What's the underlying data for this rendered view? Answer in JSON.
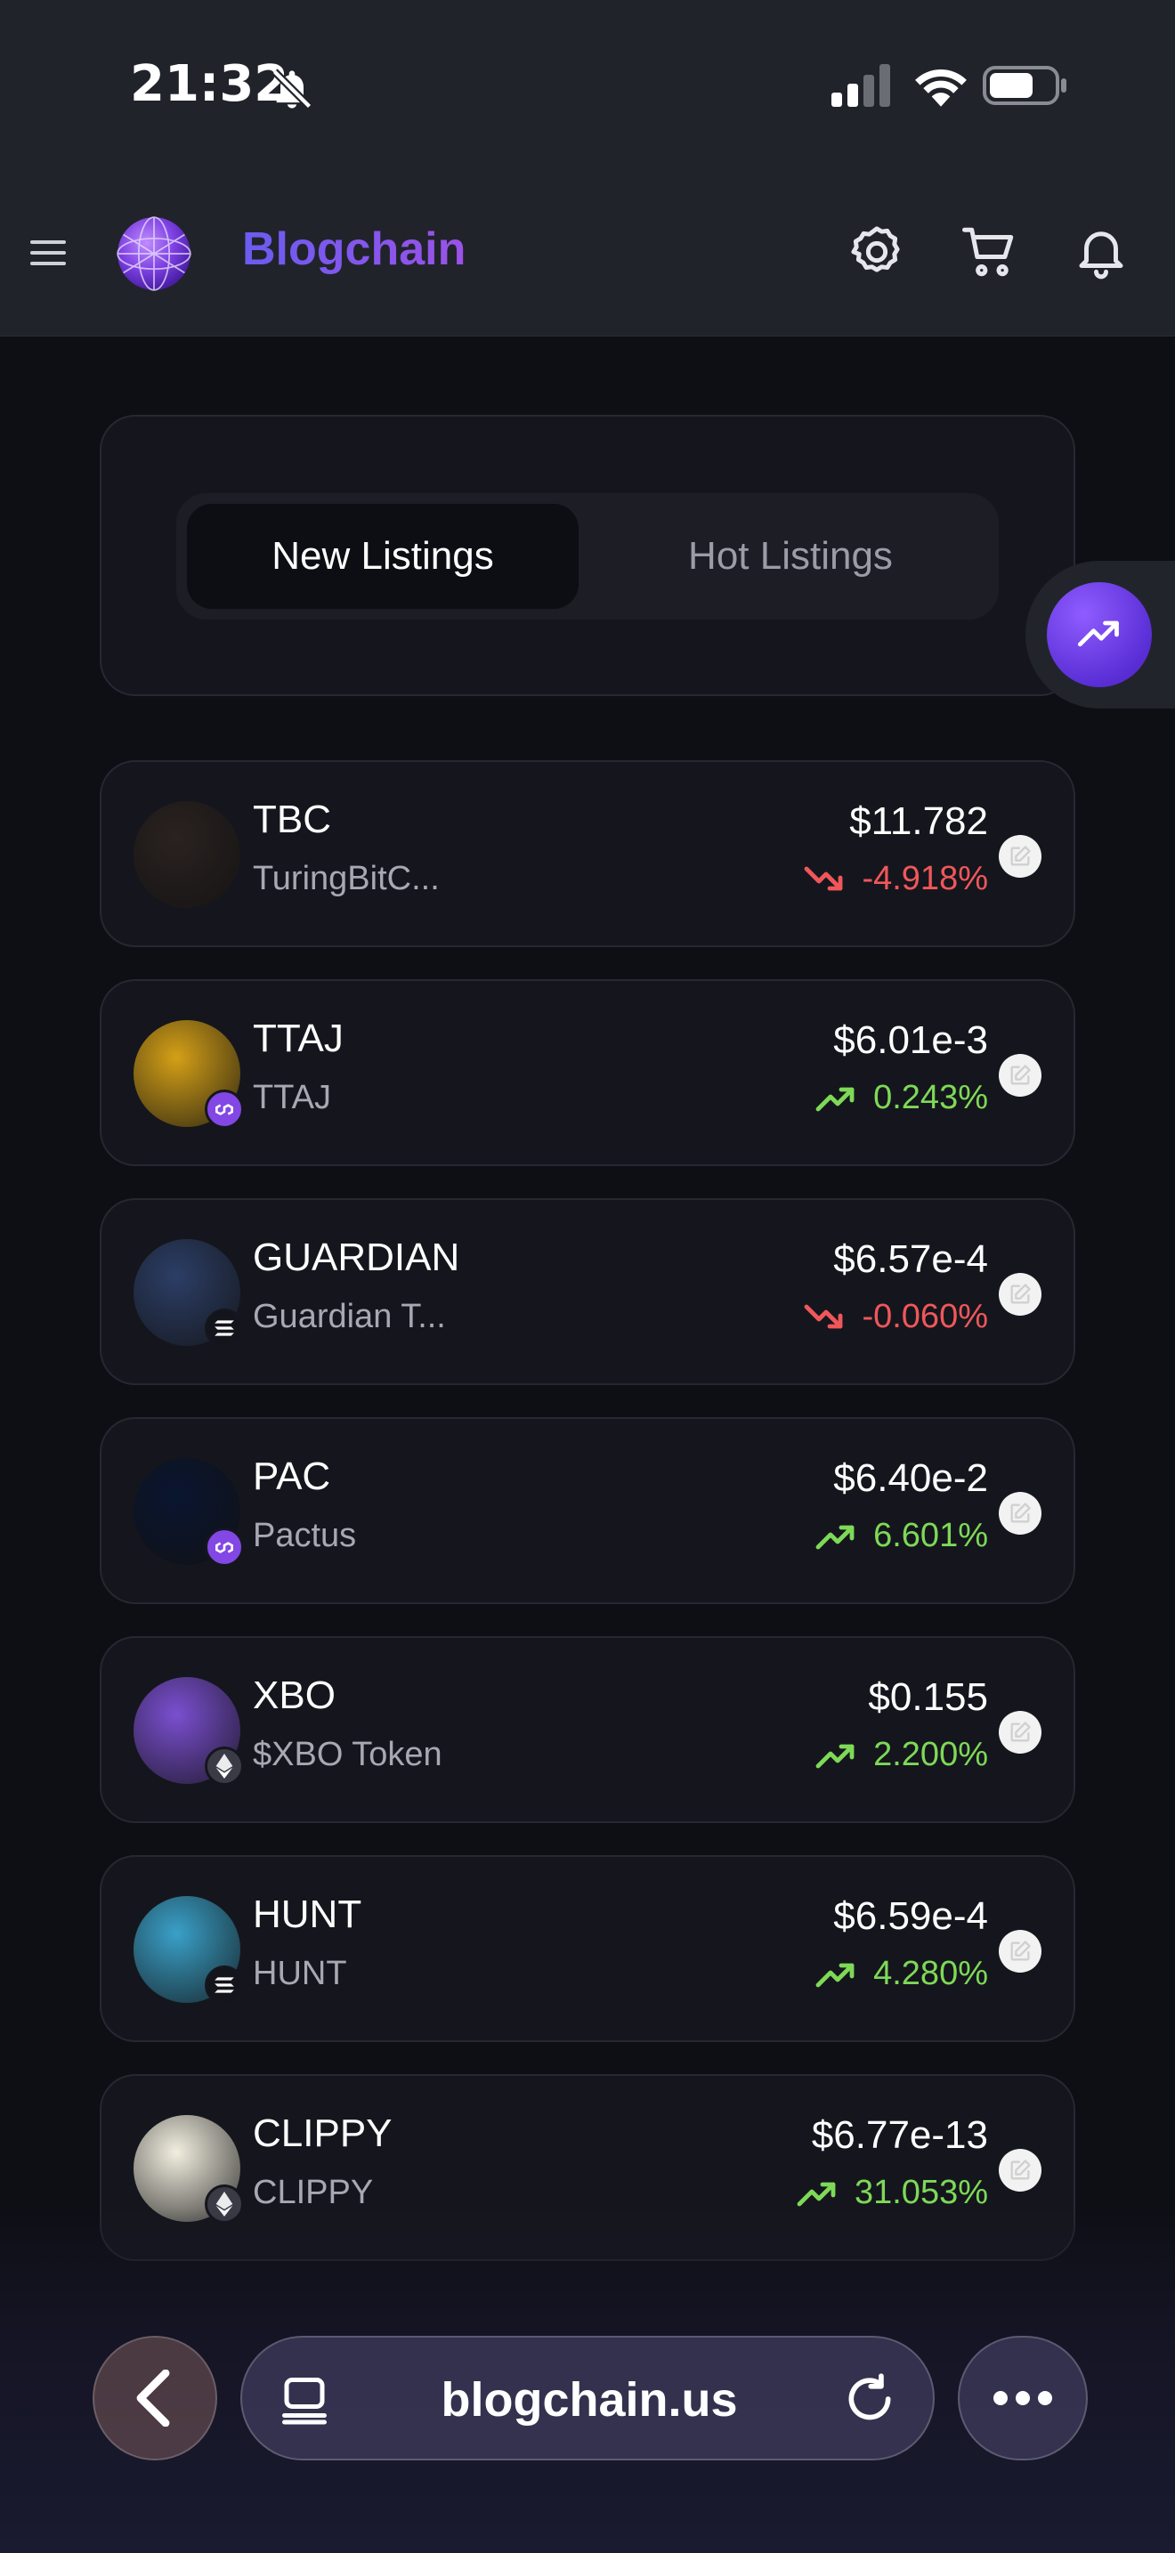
{
  "status_bar": {
    "time": "21:32"
  },
  "header": {
    "brand": "Blogchain"
  },
  "tabs": [
    {
      "label": "New Listings",
      "active": true
    },
    {
      "label": "Hot Listings",
      "active": false
    }
  ],
  "tokens": [
    {
      "symbol": "TBC",
      "name": "TuringBitC...",
      "price": "$11.782",
      "change": "-4.918%",
      "direction": "down",
      "chain": "none",
      "logo_color": "#2a2220"
    },
    {
      "symbol": "TTAJ",
      "name": "TTAJ",
      "price": "$6.01e-3",
      "change": "0.243%",
      "direction": "up",
      "chain": "polygon",
      "logo_color": "#d4a017"
    },
    {
      "symbol": "GUARDIAN",
      "name": "Guardian T...",
      "price": "$6.57e-4",
      "change": "-0.060%",
      "direction": "down",
      "chain": "solana",
      "logo_color": "#2c3e66"
    },
    {
      "symbol": "PAC",
      "name": "Pactus",
      "price": "$6.40e-2",
      "change": "6.601%",
      "direction": "up",
      "chain": "polygon",
      "logo_color": "#0a1530"
    },
    {
      "symbol": "XBO",
      "name": "$XBO Token",
      "price": "$0.155",
      "change": "2.200%",
      "direction": "up",
      "chain": "ethereum",
      "logo_color": "#7a4fd0"
    },
    {
      "symbol": "HUNT",
      "name": "HUNT",
      "price": "$6.59e-4",
      "change": "4.280%",
      "direction": "up",
      "chain": "solana",
      "logo_color": "#3aa0c8"
    },
    {
      "symbol": "CLIPPY",
      "name": "CLIPPY",
      "price": "$6.77e-13",
      "change": "31.053%",
      "direction": "up",
      "chain": "ethereum",
      "logo_color": "#f2efe0"
    }
  ],
  "browser": {
    "url": "blogchain.us"
  },
  "colors": {
    "up": "#7ed957",
    "down": "#f0575a",
    "brand_start": "#6a5cf0",
    "brand_end": "#9b52e8"
  }
}
